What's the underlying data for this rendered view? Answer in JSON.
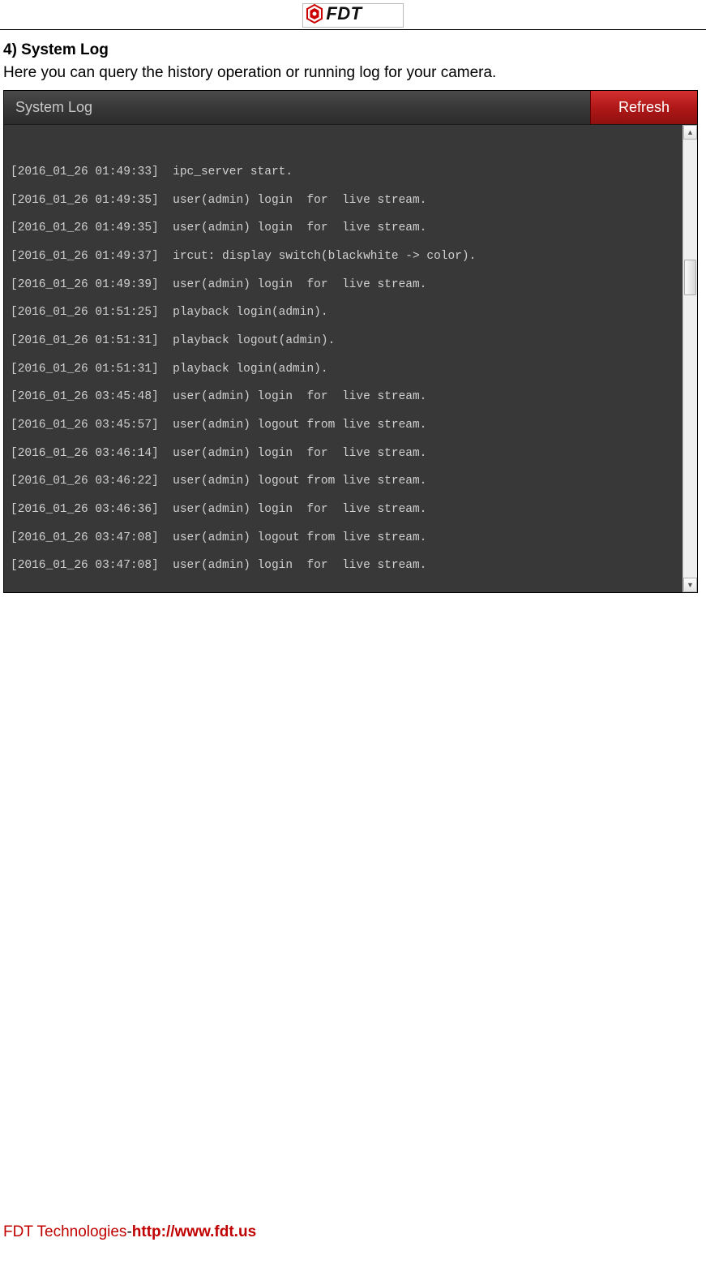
{
  "header": {
    "logo_text": "FDT"
  },
  "section": {
    "heading": "4) System Log",
    "description": "Here you can query the history operation or running log for your camera."
  },
  "log_panel": {
    "title": "System Log",
    "refresh_label": "Refresh",
    "lines": [
      "[2016_01_26 01:49:33]  ipc_server start.",
      "[2016_01_26 01:49:35]  user(admin) login  for  live stream.",
      "[2016_01_26 01:49:35]  user(admin) login  for  live stream.",
      "[2016_01_26 01:49:37]  ircut: display switch(blackwhite -> color).",
      "[2016_01_26 01:49:39]  user(admin) login  for  live stream.",
      "[2016_01_26 01:51:25]  playback login(admin).",
      "[2016_01_26 01:51:31]  playback logout(admin).",
      "[2016_01_26 01:51:31]  playback login(admin).",
      "[2016_01_26 03:45:48]  user(admin) login  for  live stream.",
      "[2016_01_26 03:45:57]  user(admin) logout from live stream.",
      "[2016_01_26 03:46:14]  user(admin) login  for  live stream.",
      "[2016_01_26 03:46:22]  user(admin) logout from live stream.",
      "[2016_01_26 03:46:36]  user(admin) login  for  live stream.",
      "[2016_01_26 03:47:08]  user(admin) logout from live stream.",
      "[2016_01_26 03:47:08]  user(admin) login  for  live stream."
    ]
  },
  "footer": {
    "company": "FDT Technologies",
    "dash": "-",
    "url": "http://www.fdt.us"
  }
}
